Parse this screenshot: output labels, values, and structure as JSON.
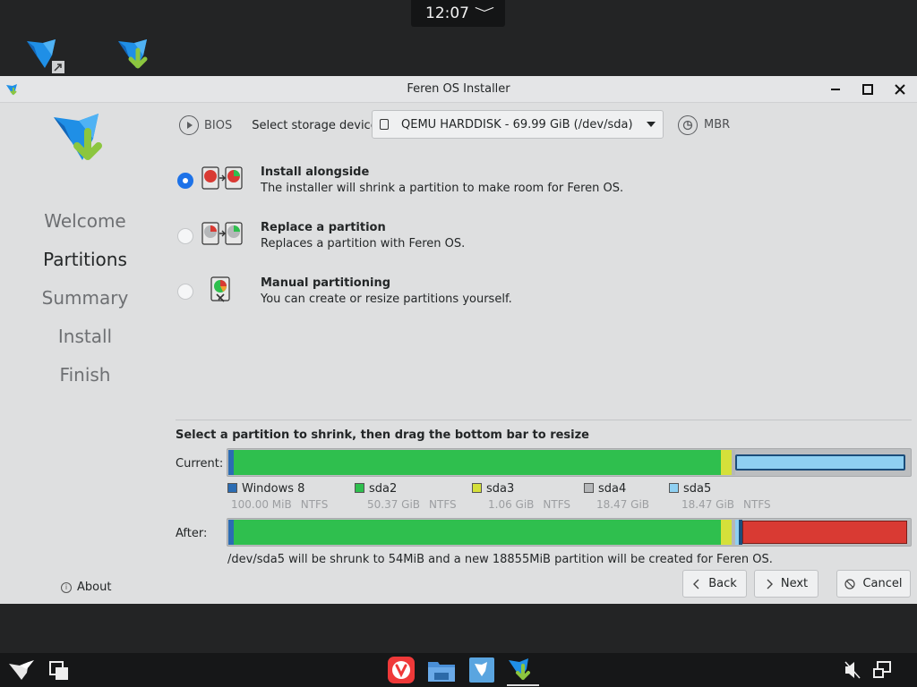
{
  "clock": {
    "time": "12:07",
    "chevron": "﹀"
  },
  "desktop_icons": [
    "feren-shortcut-icon",
    "feren-installer-icon"
  ],
  "window": {
    "title": "Feren OS Installer",
    "controls": {
      "minimize": "—",
      "maximize": "☐",
      "close": "✕"
    }
  },
  "sidebar": {
    "items": [
      {
        "label": "Welcome",
        "active": false
      },
      {
        "label": "Partitions",
        "active": true
      },
      {
        "label": "Summary",
        "active": false
      },
      {
        "label": "Install",
        "active": false
      },
      {
        "label": "Finish",
        "active": false
      }
    ],
    "about_label": "About"
  },
  "storage": {
    "bios_label": "BIOS",
    "select_label": "Select storage device:",
    "device_value": "QEMU HARDDISK - 69.99 GiB (/dev/sda)",
    "table_label": "MBR"
  },
  "options": [
    {
      "title": "Install alongside",
      "desc": "The installer will shrink a partition to make room for Feren OS.",
      "checked": true
    },
    {
      "title": "Replace a partition",
      "desc": "Replaces a partition with Feren OS.",
      "checked": false
    },
    {
      "title": "Manual partitioning",
      "desc": "You can create or resize partitions yourself.",
      "checked": false
    }
  ],
  "shrink": {
    "title": "Select a partition to shrink, then drag the bottom bar to resize",
    "current_label": "Current:",
    "after_label": "After:",
    "info": "/dev/sda5 will be shrunk to 54MiB and a new 18855MiB partition will be created for Feren OS."
  },
  "partitions": [
    {
      "name": "Windows 8",
      "size": "100.00 MiB",
      "fs": "NTFS",
      "color": "#2b6cb3"
    },
    {
      "name": "sda2",
      "size": "50.37 GiB",
      "fs": "NTFS",
      "color": "#2fbf4e"
    },
    {
      "name": "sda3",
      "size": "1.06 GiB",
      "fs": "NTFS",
      "color": "#d5e03a"
    },
    {
      "name": "sda4",
      "size": "18.47 GiB",
      "fs": "",
      "color": "#b5b7b9"
    },
    {
      "name": "sda5",
      "size": "18.47 GiB",
      "fs": "NTFS",
      "color": "#8fd0f2"
    }
  ],
  "new_partition_color": "#d93a33",
  "buttons": {
    "back": "Back",
    "next": "Next",
    "cancel": "Cancel"
  },
  "taskbar": [
    "feren-menu-icon",
    "desktop-switch-icon",
    "vivaldi-icon",
    "file-manager-icon",
    "software-store-icon",
    "installer-icon",
    "volume-muted-icon",
    "network-icon"
  ]
}
